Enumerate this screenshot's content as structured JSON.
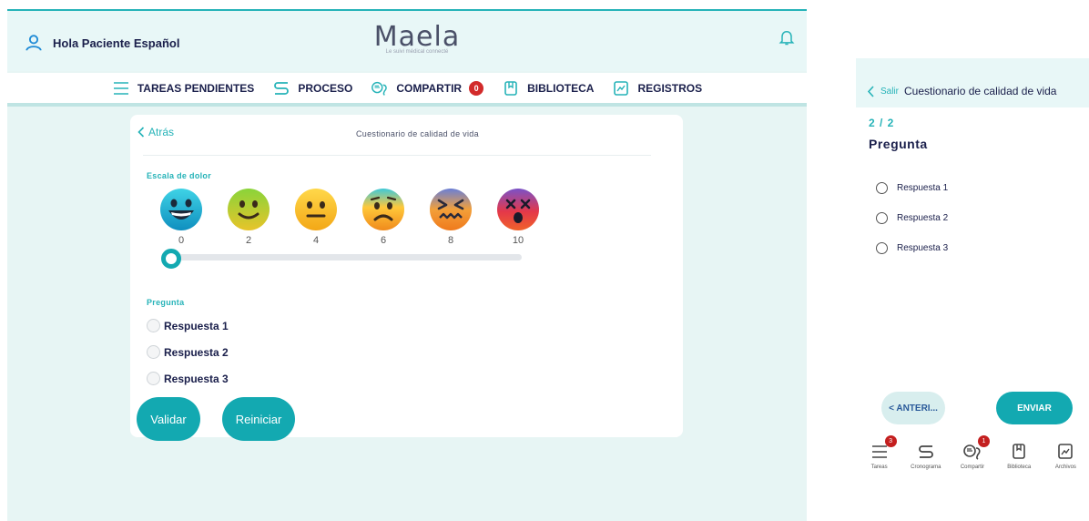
{
  "desktop": {
    "greeting": "Hola Paciente Español",
    "logo": {
      "wordmark": "Maela",
      "tagline": "Le suivi médical connecté"
    },
    "nav": [
      {
        "label": "TAREAS PENDIENTES",
        "icon": "list-icon"
      },
      {
        "label": "PROCESO",
        "icon": "route-icon"
      },
      {
        "label": "COMPARTIR",
        "icon": "chat-icon",
        "badge": "0"
      },
      {
        "label": "BIBLIOTECA",
        "icon": "book-icon"
      },
      {
        "label": "REGISTROS",
        "icon": "chart-doc-icon"
      }
    ],
    "card": {
      "back_label": "Atrás",
      "title": "Cuestionario de calidad de vida",
      "pain_label": "Escala de dolor",
      "scale": [
        "0",
        "2",
        "4",
        "6",
        "8",
        "10"
      ],
      "slider_value": 0,
      "question_label": "Pregunta",
      "answers": [
        "Respuesta 1",
        "Respuesta 2",
        "Respuesta 3"
      ],
      "validate_label": "Validar",
      "reset_label": "Reiniciar"
    },
    "colors": {
      "accent": "#13a9b1",
      "navy": "#1a1f4b",
      "background": "#e7f5f4"
    }
  },
  "phone": {
    "exit_label": "Salir",
    "title": "Cuestionario de calidad de vida",
    "counter": "2 / 2",
    "question": "Pregunta",
    "answers": [
      "Respuesta 1",
      "Respuesta 2",
      "Respuesta 3"
    ],
    "prev_label": "< ANTERI...",
    "send_label": "ENVIAR",
    "tabs": [
      {
        "label": "Tareas",
        "icon": "list-icon",
        "badge": "3"
      },
      {
        "label": "Cronograma",
        "icon": "route-icon"
      },
      {
        "label": "Compartir",
        "icon": "chat-icon",
        "badge": "1"
      },
      {
        "label": "Biblioteca",
        "icon": "book-icon"
      },
      {
        "label": "Archivos",
        "icon": "chart-doc-icon"
      }
    ]
  }
}
